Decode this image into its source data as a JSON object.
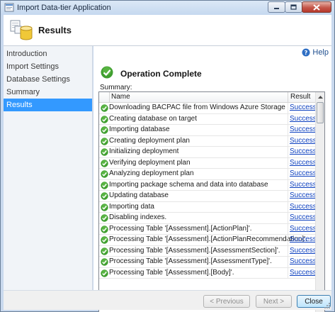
{
  "window": {
    "title": "Import Data-tier Application"
  },
  "header": {
    "title": "Results"
  },
  "nav": {
    "items": [
      {
        "label": "Introduction",
        "active": false
      },
      {
        "label": "Import Settings",
        "active": false
      },
      {
        "label": "Database Settings",
        "active": false
      },
      {
        "label": "Summary",
        "active": false
      },
      {
        "label": "Results",
        "active": true
      }
    ]
  },
  "help": {
    "label": "Help"
  },
  "status": {
    "title": "Operation Complete",
    "icon": "success-check-icon"
  },
  "summary": {
    "label": "Summary:",
    "columns": {
      "name": "Name",
      "result": "Result"
    },
    "rows": [
      {
        "name": "Downloading BACPAC file from Windows Azure Storage",
        "result": "Success"
      },
      {
        "name": "Creating database on target",
        "result": "Success"
      },
      {
        "name": "Importing database",
        "result": "Success"
      },
      {
        "name": "Creating deployment plan",
        "result": "Success"
      },
      {
        "name": "Initializing deployment",
        "result": "Success"
      },
      {
        "name": "Verifying deployment plan",
        "result": "Success"
      },
      {
        "name": "Analyzing deployment plan",
        "result": "Success"
      },
      {
        "name": "Importing package schema and data into database",
        "result": "Success"
      },
      {
        "name": "Updating database",
        "result": "Success"
      },
      {
        "name": "Importing data",
        "result": "Success"
      },
      {
        "name": "Disabling indexes.",
        "result": "Success"
      },
      {
        "name": "Processing Table '[Assessment].[ActionPlan]'.",
        "result": "Success"
      },
      {
        "name": "Processing Table '[Assessment].[ActionPlanRecommendation]'.",
        "result": "Success"
      },
      {
        "name": "Processing Table '[Assessment].[AssessmentSection]'.",
        "result": "Success"
      },
      {
        "name": "Processing Table '[Assessment].[AssessmentType]'.",
        "result": "Success"
      },
      {
        "name": "Processing Table '[Assessment].[Body]'.",
        "result": "Success"
      }
    ]
  },
  "footer": {
    "previous": "< Previous",
    "next": "Next >",
    "close": "Close"
  },
  "colors": {
    "nav_active": "#3399ff",
    "link": "#0b3fbf",
    "success": "#3f9e2f"
  }
}
